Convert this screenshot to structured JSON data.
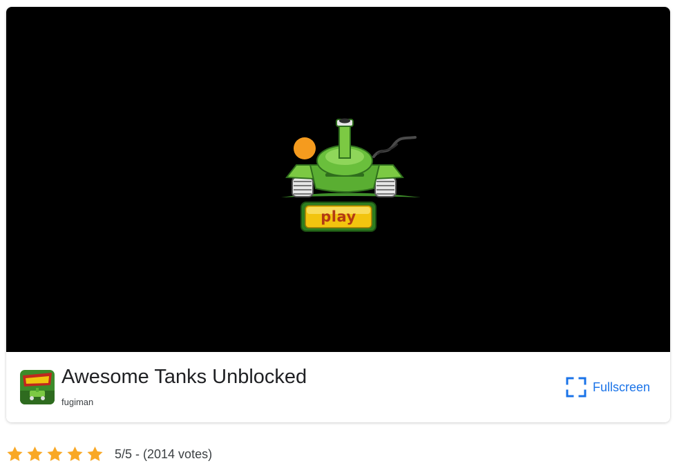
{
  "game": {
    "title": "Awesome Tanks Unblocked",
    "developer": "fugiman",
    "thumbnail_icon": "awesome-tanks-thumbnail",
    "play_label": "play"
  },
  "actions": {
    "fullscreen_label": "Fullscreen",
    "fullscreen_icon": "fullscreen-icon"
  },
  "rating": {
    "stars_filled": 5,
    "stars_total": 5,
    "text": "5/5 - (2014 votes)"
  },
  "colors": {
    "accent": "#1a73e8",
    "star": "#f9a825",
    "game_background": "#000000",
    "tank_green": "#6abf3c",
    "play_button": "#f2c40f"
  }
}
